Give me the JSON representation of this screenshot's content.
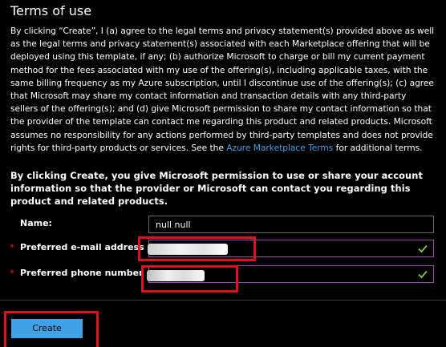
{
  "title": "Terms of use",
  "terms": {
    "text_before_link": "By clicking “Create”, I (a) agree to the legal terms and privacy statement(s) provided above as well as the legal terms and privacy statement(s) associated with each Marketplace offering that will be deployed using this template, if any; (b) authorize Microsoft to charge or bill my current payment method for the fees associated with my use of the offering(s), including applicable taxes, with the same billing frequency as my Azure subscription, until I discontinue use of the offering(s); (c) agree that Microsoft may share my contact information and transaction details with any third-party sellers of the offering(s); and (d) give Microsoft permission to share my contact information so that the provider of the template can contact me regarding this product and related products. Microsoft assumes no responsibility for any actions performed by third-party templates and does not provide rights for third-party products or services. See the ",
    "link_text": "Azure Marketplace Terms",
    "text_after_link": " for additional terms."
  },
  "permission_text": "By clicking Create, you give Microsoft permission to use or share your account information so that the provider or Microsoft can contact you regarding this product and related products.",
  "form": {
    "name_label": "Name:",
    "name_value": "null null",
    "email_label": "Preferred e-mail address",
    "email_value": "",
    "phone_label": "Preferred phone number",
    "phone_value": "",
    "required_marker": "*"
  },
  "create_label": "Create",
  "colors": {
    "background": "#000000",
    "link": "#3fa2e6",
    "button": "#3fa2e6",
    "required": "#e81123",
    "valid_border": "#9a4aa8",
    "check": "#8cc63f",
    "highlight": "#e0101f"
  },
  "icons": {
    "valid": "checkmark-icon"
  }
}
